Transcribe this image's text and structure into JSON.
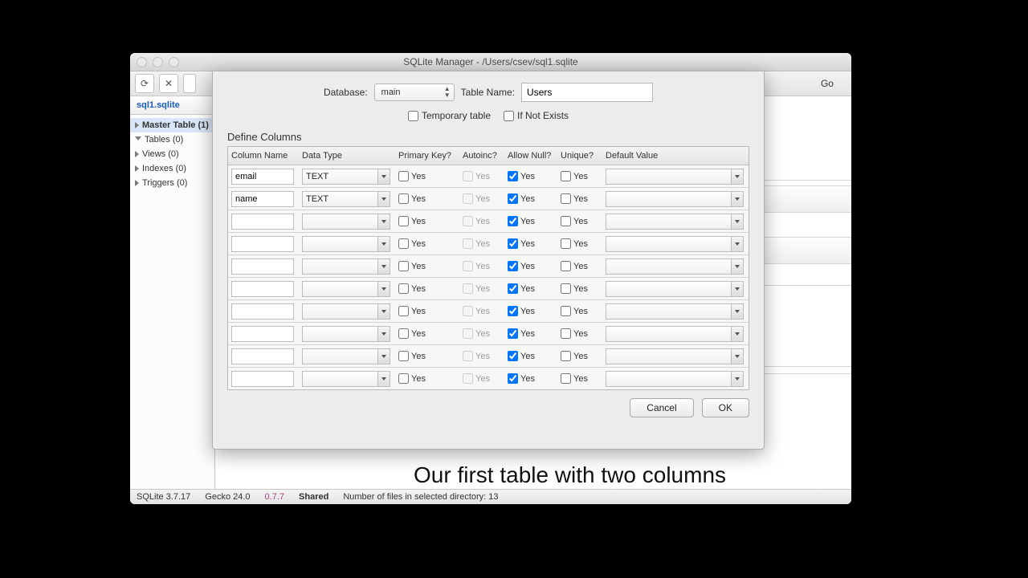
{
  "window": {
    "title": "SQLite Manager - /Users/csev/sql1.sqlite",
    "go": "Go"
  },
  "sidebar": {
    "db_tab": "sql1.sqlite",
    "items": [
      {
        "label": "Master Table (1)"
      },
      {
        "label": "Tables (0)"
      },
      {
        "label": "Views (0)"
      },
      {
        "label": "Indexes (0)"
      },
      {
        "label": "Triggers (0)"
      }
    ]
  },
  "dialog": {
    "database_label": "Database:",
    "database_value": "main",
    "table_name_label": "Table Name:",
    "table_name_value": "Users",
    "temporary_label": "Temporary table",
    "ifnotexists_label": "If Not Exists",
    "section": "Define Columns",
    "headers": {
      "name": "Column Name",
      "type": "Data Type",
      "pk": "Primary Key?",
      "ai": "Autoinc?",
      "an": "Allow Null?",
      "uq": "Unique?",
      "def": "Default Value"
    },
    "yes": "Yes",
    "cancel": "Cancel",
    "ok": "OK",
    "rows": [
      {
        "name": "email",
        "type": "TEXT",
        "pk": false,
        "ai": false,
        "an": true,
        "uq": false,
        "def": ""
      },
      {
        "name": "name",
        "type": "TEXT",
        "pk": false,
        "ai": false,
        "an": true,
        "uq": false,
        "def": ""
      },
      {
        "name": "",
        "type": "",
        "pk": false,
        "ai": false,
        "an": true,
        "uq": false,
        "def": ""
      },
      {
        "name": "",
        "type": "",
        "pk": false,
        "ai": false,
        "an": true,
        "uq": false,
        "def": ""
      },
      {
        "name": "",
        "type": "",
        "pk": false,
        "ai": false,
        "an": true,
        "uq": false,
        "def": ""
      },
      {
        "name": "",
        "type": "",
        "pk": false,
        "ai": false,
        "an": true,
        "uq": false,
        "def": ""
      },
      {
        "name": "",
        "type": "",
        "pk": false,
        "ai": false,
        "an": true,
        "uq": false,
        "def": ""
      },
      {
        "name": "",
        "type": "",
        "pk": false,
        "ai": false,
        "an": true,
        "uq": false,
        "def": ""
      },
      {
        "name": "",
        "type": "",
        "pk": false,
        "ai": false,
        "an": true,
        "uq": false,
        "def": ""
      },
      {
        "name": "",
        "type": "",
        "pk": false,
        "ai": false,
        "an": true,
        "uq": false,
        "def": ""
      }
    ]
  },
  "status": {
    "sqlite": "SQLite 3.7.17",
    "gecko": "Gecko 24.0",
    "version": "0.7.7",
    "mode": "Shared",
    "files": "Number of files in selected directory: 13"
  },
  "caption": "Our first table with two columns"
}
